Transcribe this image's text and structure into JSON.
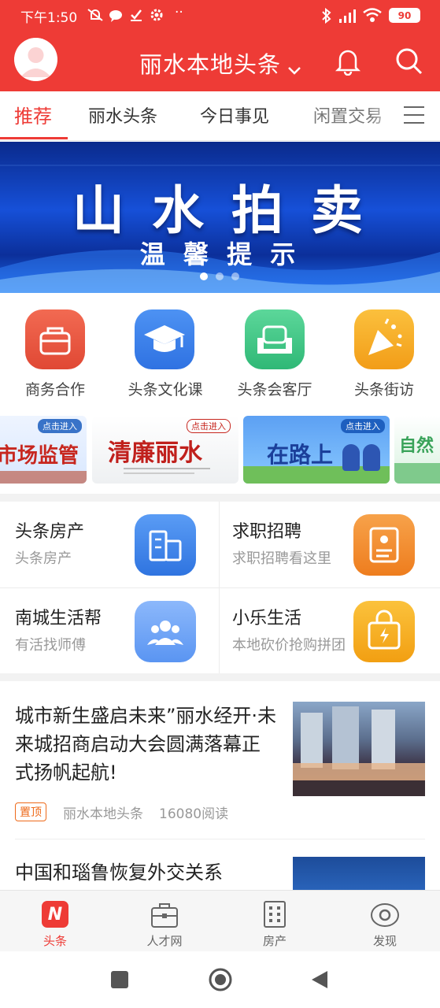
{
  "status": {
    "time": "下午1:50",
    "dots": "··",
    "battery": "90"
  },
  "header": {
    "title": "丽水本地头条"
  },
  "tabs": [
    {
      "label": "推荐"
    },
    {
      "label": "丽水头条"
    },
    {
      "label": "今日事见"
    },
    {
      "label": "闲置交易"
    }
  ],
  "banner": {
    "title": "山 水 拍 卖",
    "subtitle": "温 馨 提 示"
  },
  "grid": [
    {
      "label": "商务合作",
      "icon": "briefcase-icon",
      "color": "#e8533f"
    },
    {
      "label": "头条文化课",
      "icon": "graduation-cap-icon",
      "color": "#3c82ea"
    },
    {
      "label": "头条会客厅",
      "icon": "sofa-icon",
      "color": "#3fc487"
    },
    {
      "label": "头条街访",
      "icon": "party-popper-icon",
      "color": "#f4a922"
    }
  ],
  "strip": [
    {
      "label": "市场监管",
      "tag": "点击进入"
    },
    {
      "label": "清廉丽水",
      "tag": "点击进入"
    },
    {
      "label": "在路上",
      "tag": "点击进入"
    },
    {
      "label": "自然",
      "tag": ""
    }
  ],
  "cards": [
    {
      "title": "头条房产",
      "sub": "头条房产",
      "icon": "building-icon",
      "color": "#3f86ee"
    },
    {
      "title": "求职招聘",
      "sub": "求职招聘看这里",
      "icon": "resume-icon",
      "color": "#f28b2a"
    },
    {
      "title": "南城生活帮",
      "sub": "有活找师傅",
      "icon": "people-icon",
      "color": "#5b9cf6"
    },
    {
      "title": "小乐生活",
      "sub": "本地砍价抢购拼团",
      "icon": "shopping-bag-icon",
      "color": "#f4a51e"
    }
  ],
  "news": [
    {
      "title": "城市新生盛启未来”丽水经开·未来城招商启动大会圆满落幕正式扬帆起航!",
      "tag": "置顶",
      "source": "丽水本地头条",
      "reads": "16080阅读"
    },
    {
      "title": "中国和瑙鲁恢复外交关系"
    }
  ],
  "tabbar": [
    {
      "label": "头条",
      "icon": "news-icon",
      "active": true
    },
    {
      "label": "人才网",
      "icon": "briefcase-icon"
    },
    {
      "label": "房产",
      "icon": "building-icon"
    },
    {
      "label": "发现",
      "icon": "eye-icon"
    }
  ],
  "colors": {
    "brand": "#ee3b36",
    "text": "#222222"
  }
}
